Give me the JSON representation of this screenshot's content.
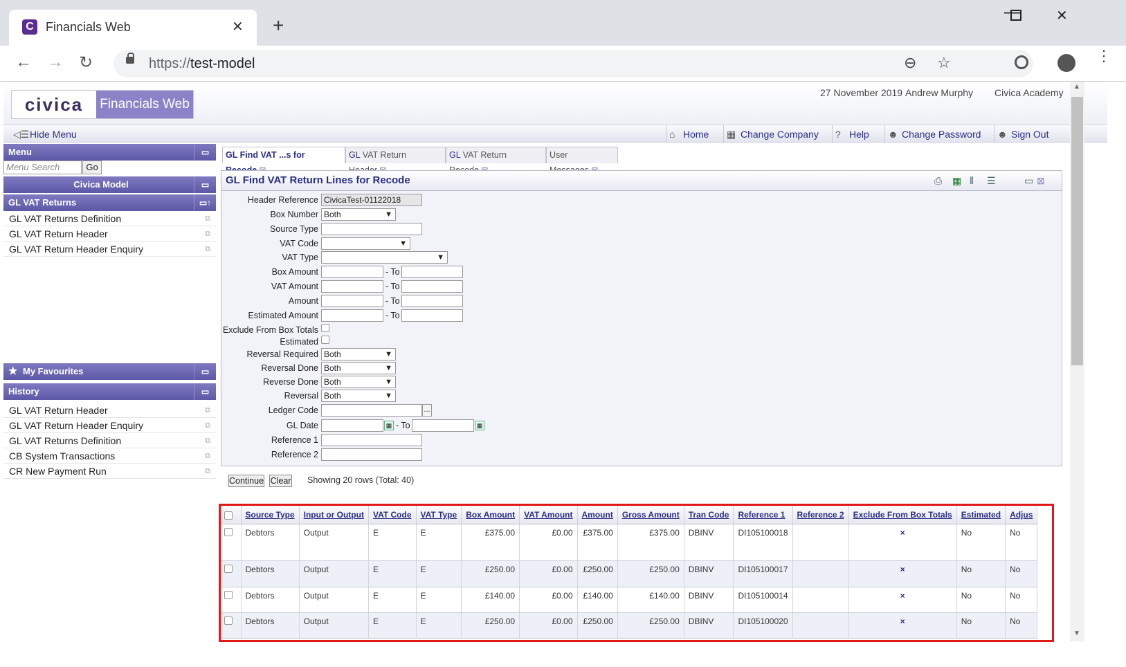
{
  "browser": {
    "tab_title": "Financials Web",
    "favicon": "C",
    "url_proto": "https://",
    "url_host": "test-model"
  },
  "header": {
    "logo_left": "civica",
    "logo_right": "Financials Web",
    "date": "27 November 2019",
    "user": "Andrew Murphy",
    "org": "Civica Academy"
  },
  "menubar": {
    "hide_menu": "Hide Menu",
    "home": "Home",
    "change_company": "Change Company",
    "help": "Help",
    "change_password": "Change Password",
    "sign_out": "Sign Out"
  },
  "sidebar": {
    "menu_title": "Menu",
    "search_placeholder": "Menu Search",
    "go": "Go",
    "model": "Civica Model",
    "section": "GL VAT Returns",
    "items": [
      "GL VAT Returns Definition",
      "GL VAT Return Header",
      "GL VAT Return Header Enquiry"
    ],
    "favourites_title": "My Favourites",
    "history_title": "History",
    "history": [
      "GL VAT Return Header",
      "GL VAT Return Header Enquiry",
      "GL VAT Returns Definition",
      "CB System Transactions",
      "CR New Payment Run"
    ]
  },
  "tabs": [
    {
      "prefix": "GL",
      "label": " Find VAT ...s for Recode"
    },
    {
      "prefix": "GL",
      "label": " VAT Return Header"
    },
    {
      "prefix": "GL",
      "label": " VAT Return Recode"
    },
    {
      "prefix": "",
      "label": "User Messages"
    }
  ],
  "form": {
    "title": "GL Find VAT Return Lines for Recode",
    "labels": {
      "header_ref": "Header Reference",
      "box_number": "Box Number",
      "source_type": "Source Type",
      "vat_code": "VAT Code",
      "vat_type": "VAT Type",
      "box_amount": "Box Amount",
      "vat_amount": "VAT Amount",
      "amount": "Amount",
      "estimated_amount": "Estimated Amount",
      "exclude": "Exclude From Box Totals",
      "estimated": "Estimated",
      "reversal_required": "Reversal Required",
      "reversal_done": "Reversal Done",
      "reverse_done": "Reverse Done",
      "reversal": "Reversal",
      "ledger_code": "Ledger Code",
      "gl_date": "GL Date",
      "reference1": "Reference 1",
      "reference2": "Reference 2"
    },
    "to": "- To",
    "values": {
      "header_ref": "CivicaTest-01122018",
      "box_number": "Both",
      "reversal_required": "Both",
      "reversal_done": "Both",
      "reverse_done": "Both",
      "reversal": "Both"
    },
    "continue": "Continue",
    "clear": "Clear",
    "showing": "Showing 20 rows (Total: 40)"
  },
  "grid": {
    "columns": [
      "Source Type",
      "Input or Output",
      "VAT Code",
      "VAT Type",
      "Box Amount",
      "VAT Amount",
      "Amount",
      "Gross Amount",
      "Tran Code",
      "Reference 1",
      "Reference 2",
      "Exclude From Box Totals",
      "Estimated",
      "Adjus"
    ],
    "rows": [
      [
        "Debtors",
        "Output",
        "E",
        "E",
        "£375.00",
        "£0.00",
        "£375.00",
        "£375.00",
        "DBINV",
        "DI105100018",
        "",
        "×",
        "No",
        "No"
      ],
      [
        "Debtors",
        "Output",
        "E",
        "E",
        "£250.00",
        "£0.00",
        "£250.00",
        "£250.00",
        "DBINV",
        "DI105100017",
        "",
        "×",
        "No",
        "No"
      ],
      [
        "Debtors",
        "Output",
        "E",
        "E",
        "£140.00",
        "£0.00",
        "£140.00",
        "£140.00",
        "DBINV",
        "DI105100014",
        "",
        "×",
        "No",
        "No"
      ],
      [
        "Debtors",
        "Output",
        "E",
        "E",
        "£250.00",
        "£0.00",
        "£250.00",
        "£250.00",
        "DBINV",
        "DI105100020",
        "",
        "×",
        "No",
        "No"
      ]
    ]
  }
}
